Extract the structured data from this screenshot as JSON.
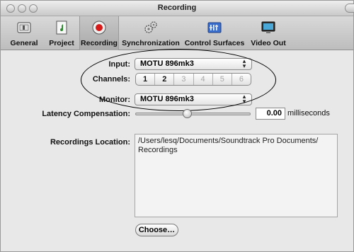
{
  "window": {
    "title": "Recording"
  },
  "toolbar": {
    "tabs": [
      {
        "label": "General",
        "icon": "general-icon"
      },
      {
        "label": "Project",
        "icon": "project-icon"
      },
      {
        "label": "Recording",
        "icon": "record-icon",
        "selected": true
      },
      {
        "label": "Synchronization",
        "icon": "gears-icon"
      },
      {
        "label": "Control Surfaces",
        "icon": "control-surfaces-icon"
      },
      {
        "label": "Video Out",
        "icon": "video-out-icon"
      }
    ]
  },
  "input": {
    "label": "Input:",
    "value": "MOTU 896mk3"
  },
  "channels": {
    "label": "Channels:",
    "options": [
      "1",
      "2",
      "3",
      "4",
      "5",
      "6"
    ],
    "enabled": [
      "1",
      "2"
    ]
  },
  "monitor": {
    "label": "Monitor:",
    "value": "MOTU 896mk3"
  },
  "latency": {
    "label": "Latency Compensation:",
    "value": "0.00",
    "unit": "milliseconds",
    "slider_fraction": 0.45
  },
  "location": {
    "label": "Recordings Location:",
    "line1": "/Users/lesq/Documents/Soundtrack Pro Documents/",
    "line2": "Recordings"
  },
  "choose_button": {
    "label": "Choose…"
  },
  "colors": {
    "window_bg": "#e8e8e8",
    "record_red": "#d61a1a",
    "selected_tab": "#b5b5b5"
  }
}
